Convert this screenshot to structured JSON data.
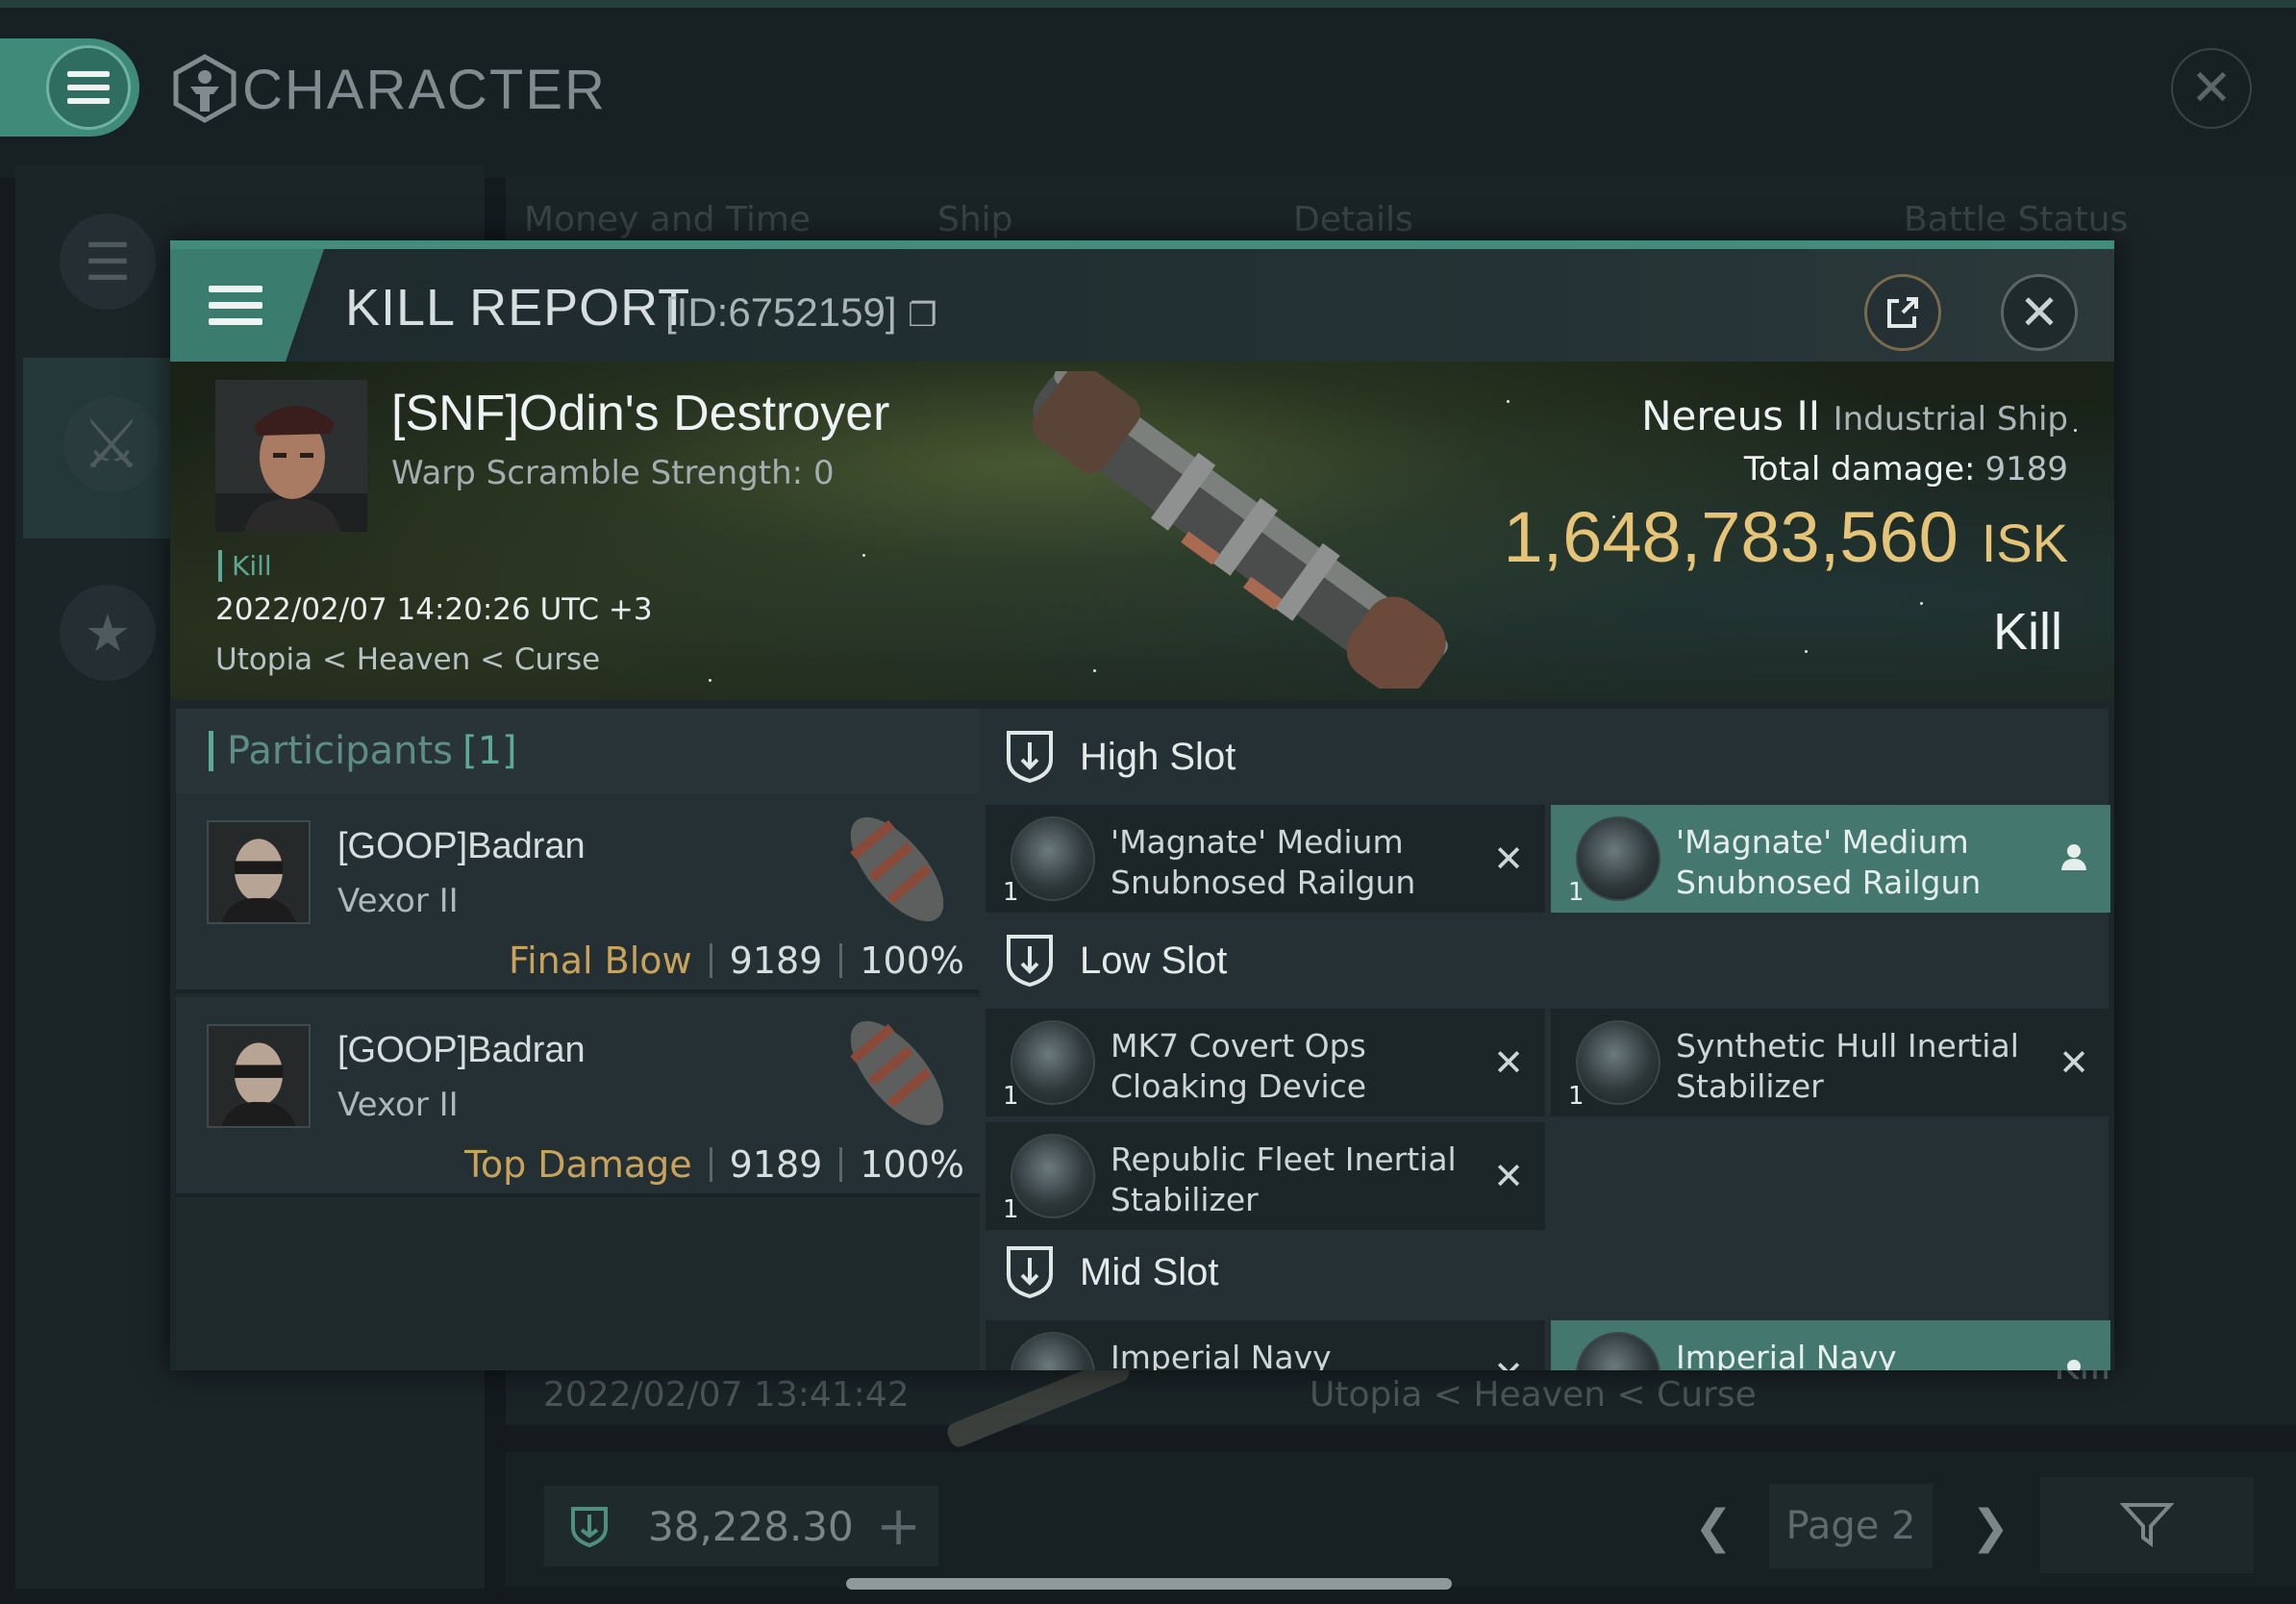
{
  "window": {
    "title": "CHARACTER"
  },
  "background_table": {
    "columns": [
      "Money and Time",
      "Ship",
      "Details",
      "Battle Status"
    ],
    "row_date": "2022/02/07 13:41:42",
    "row_location": "Utopia < Heaven < Curse",
    "row_result": "Kill"
  },
  "footer": {
    "wallet_value": "38,228.30",
    "page_label": "Page 2"
  },
  "kill_report": {
    "title": "KILL REPORT",
    "id_label": "[ID:6752159]",
    "victim": {
      "name": "[SNF]Odin's Destroyer",
      "warp_scramble": "Warp Scramble Strength: 0",
      "tag": "Kill",
      "datetime": "2022/02/07 14:20:26 UTC +3",
      "location": "Utopia < Heaven < Curse"
    },
    "ship": {
      "name": "Nereus II",
      "class": "Industrial Ship",
      "total_damage_label": "Total damage:",
      "total_damage": "9189",
      "isk_value": "1,648,783,560",
      "isk_unit": "ISK",
      "result": "Kill"
    },
    "participants": {
      "label": "Participants",
      "count": "[1]",
      "rows": [
        {
          "name": "[GOOP]Badran",
          "ship": "Vexor II",
          "role": "Final Blow",
          "damage": "9189",
          "percent": "100%"
        },
        {
          "name": "[GOOP]Badran",
          "ship": "Vexor II",
          "role": "Top Damage",
          "damage": "9189",
          "percent": "100%"
        }
      ]
    },
    "slots": {
      "high": {
        "label": "High Slot",
        "modules": [
          {
            "name": "'Magnate' Medium Snubnosed Railgun",
            "qty": "1",
            "status": "destroyed"
          },
          {
            "name": "'Magnate' Medium Snubnosed Railgun",
            "qty": "1",
            "status": "dropped"
          }
        ]
      },
      "low": {
        "label": "Low Slot",
        "modules": [
          {
            "name": "MK7 Covert Ops Cloaking Device",
            "qty": "1",
            "status": "destroyed"
          },
          {
            "name": "Synthetic Hull Inertial Stabilizer",
            "qty": "1",
            "status": "destroyed"
          },
          {
            "name": "Republic Fleet Inertial Stabilizer",
            "qty": "1",
            "status": "destroyed"
          }
        ]
      },
      "mid": {
        "label": "Mid Slot",
        "modules": [
          {
            "name": "Imperial Navy",
            "status": "destroyed"
          },
          {
            "name": "Imperial Navy",
            "status": "dropped"
          }
        ]
      }
    }
  },
  "colors": {
    "accent": "#3f8d7c",
    "isk_gold": "#e6c477",
    "role_gold": "#c9a35c",
    "selected_module": "#44786e"
  },
  "icons": [
    "menu-icon",
    "character-icon",
    "close-icon",
    "share-icon",
    "shield-slot-icon",
    "user-icon",
    "wallet-icon",
    "plus-icon",
    "chevron-left-icon",
    "chevron-right-icon",
    "filter-icon"
  ]
}
